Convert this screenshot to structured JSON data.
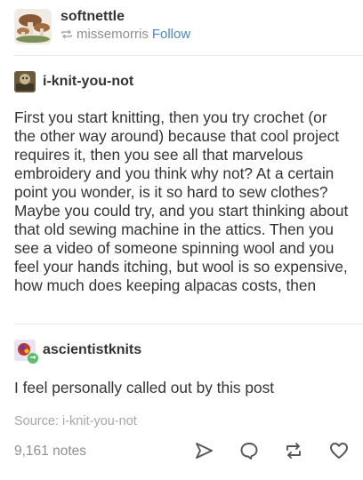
{
  "header": {
    "blog_name": "softnettle",
    "reblogged_from": "missemorris",
    "follow_label": "Follow"
  },
  "trail": [
    {
      "username": "i-knit-you-not",
      "text": "First you start knitting, then you try crochet (or the other way around) because that cool project requires it, then you see all that marvelous embroidery and you think why not? At a certain point you wonder, is it so hard to sew clothes? Maybe you could try, and you start thinking about that old sewing machine in the attics. Then you see a video of someone spinning wool and you feel your hands itching, but wool is so expensive, how much does keeping alpacas costs, then"
    },
    {
      "username": "ascientistknits",
      "text": "I feel personally called out by this post"
    }
  ],
  "footer": {
    "source": "Source: i-knit-you-not",
    "notes": "9,161 notes"
  },
  "icons": {
    "reblog_small": "reblog-icon",
    "share": "send-icon",
    "reply": "speech-bubble-icon",
    "reblog": "reblog-icon",
    "like": "heart-icon"
  },
  "colors": {
    "link": "#4b87c5",
    "muted_text": "#8f8f8f",
    "body_text": "#333333",
    "reblog_badge": "#5bbd6b"
  }
}
